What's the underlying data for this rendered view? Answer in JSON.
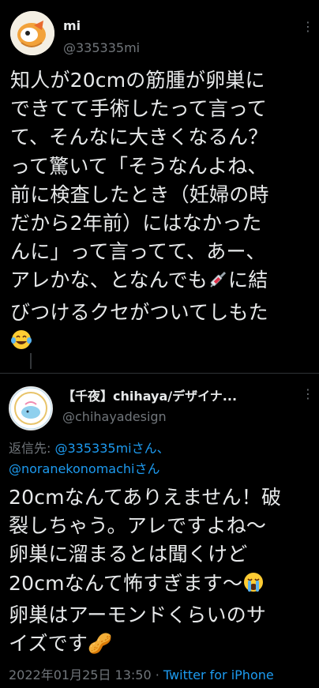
{
  "tweet": {
    "author_name": "mi",
    "author_handle": "@335335mi",
    "more_icon": "⋮",
    "lines": [
      "知人が20cmの筋腫が卵巣に",
      "できてて手術したって言って",
      "て、そんなに大きくなるん？",
      "って驚いて「そうなんよね、",
      "前に検査したとき（妊婦の時",
      "だから2年前）にはなかった",
      "んに」って言ってて、あー、",
      "アレかな、となんでも",
      "に結",
      "びつけるクセがついてしもた"
    ]
  },
  "reply": {
    "author_name": "【千夜】chihaya/デザイナ...",
    "author_handle": "@chihayadesign",
    "more_icon": "⋮",
    "reply_prefix": "返信先: ",
    "mention1": "@335335miさん、",
    "mention2": "@noranekonomachiさん",
    "lines": [
      "20cmなんてありえません！破",
      "裂しちゃう。アレですよね〜",
      "卵巣に溜まるとは聞くけど",
      "20cmなんて怖すぎます〜",
      "卵巣はアーモンドくらいのサ",
      "イズです🥜"
    ],
    "timestamp": "2022年01月25日 13:50",
    "separator": " · ",
    "via": "Twitter for iPhone"
  }
}
